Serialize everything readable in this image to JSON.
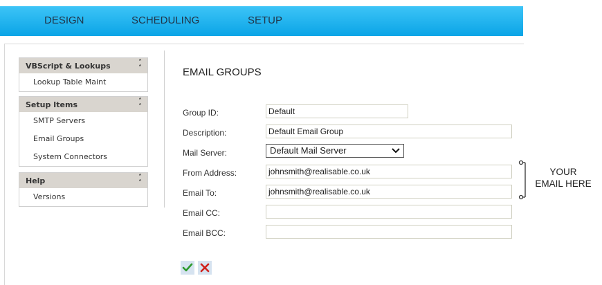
{
  "topnav": {
    "items": [
      "DESIGN",
      "SCHEDULING",
      "SETUP"
    ]
  },
  "sidebar": {
    "panels": [
      {
        "title": "VBScript & Lookups",
        "items": [
          "Lookup Table Maint"
        ]
      },
      {
        "title": "Setup Items",
        "items": [
          "SMTP Servers",
          "Email Groups",
          "System Connectors"
        ]
      },
      {
        "title": "Help",
        "items": [
          "Versions"
        ]
      }
    ],
    "collapse_icon": "double-chevron-up-icon"
  },
  "form": {
    "title": "EMAIL GROUPS",
    "group_id": {
      "label": "Group ID:",
      "value": "Default"
    },
    "description": {
      "label": "Description:",
      "value": "Default Email Group"
    },
    "mail_server": {
      "label": "Mail Server:",
      "value": "Default Mail Server"
    },
    "from_address": {
      "label": "From Address:",
      "value": "johnsmith@realisable.co.uk"
    },
    "email_to": {
      "label": "Email To:",
      "value": "johnsmith@realisable.co.uk"
    },
    "email_cc": {
      "label": "Email CC:",
      "value": ""
    },
    "email_bcc": {
      "label": "Email BCC:",
      "value": ""
    }
  },
  "annotation": {
    "line1": "YOUR",
    "line2": "EMAIL HERE"
  },
  "actions": {
    "save_icon": "checkmark-icon",
    "cancel_icon": "x-icon"
  },
  "colors": {
    "nav_bg_top": "#3dc4f7",
    "nav_bg_bottom": "#0aa4e6",
    "panel_header": "#d9d5cf",
    "save_green": "#2e9b2e",
    "cancel_red": "#d0201a"
  }
}
